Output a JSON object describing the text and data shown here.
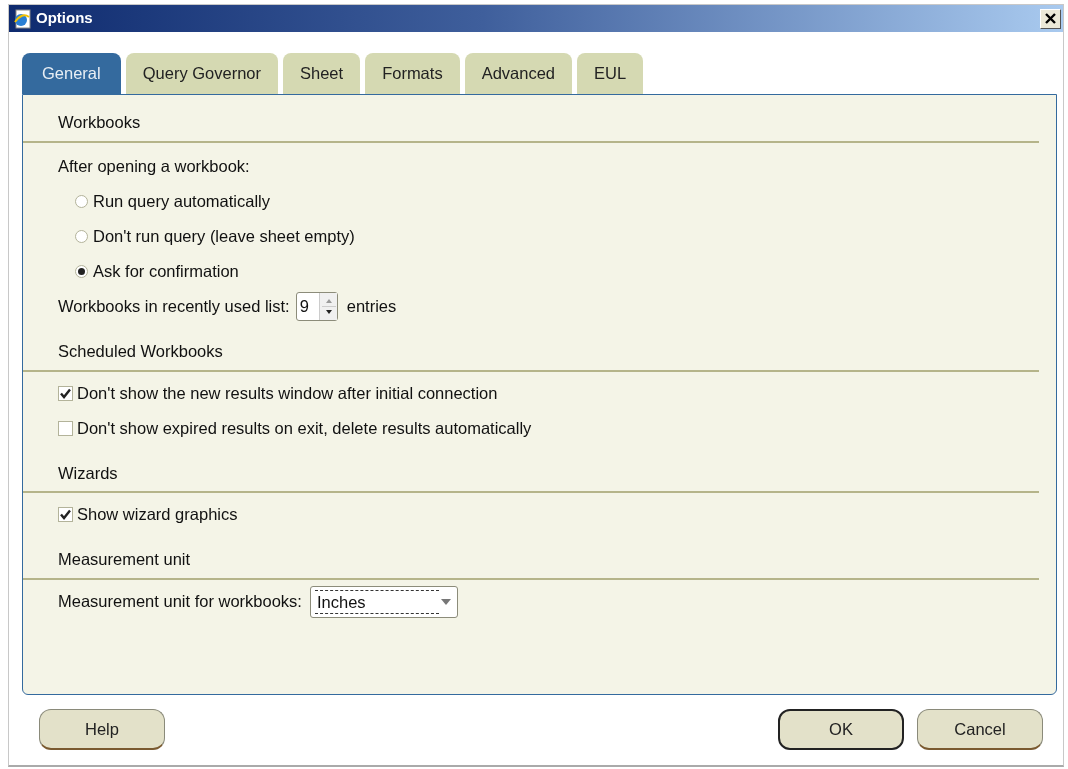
{
  "window": {
    "title": "Options"
  },
  "tabs": [
    {
      "label": "General",
      "selected": true
    },
    {
      "label": "Query Governor",
      "selected": false
    },
    {
      "label": "Sheet",
      "selected": false
    },
    {
      "label": "Formats",
      "selected": false
    },
    {
      "label": "Advanced",
      "selected": false
    },
    {
      "label": "EUL",
      "selected": false
    }
  ],
  "sections": [
    {
      "title": "Workbooks",
      "items": [
        {
          "kind": "label",
          "text": "After opening a workbook:"
        },
        {
          "kind": "radio",
          "label": "Run query automatically",
          "selected": false
        },
        {
          "kind": "radio",
          "label": "Don't run query (leave sheet empty)",
          "selected": false
        },
        {
          "kind": "radio",
          "label": "Ask for confirmation",
          "selected": true
        },
        {
          "kind": "spinner",
          "label": "Workbooks in recently used list:",
          "value": "9",
          "suffix": "entries"
        }
      ]
    },
    {
      "title": "Scheduled Workbooks",
      "items": [
        {
          "kind": "checkbox",
          "label": "Don't show the new results window after initial connection",
          "checked": true
        },
        {
          "kind": "checkbox",
          "label": "Don't show expired results on exit, delete results automatically",
          "checked": false
        }
      ]
    },
    {
      "title": "Wizards",
      "items": [
        {
          "kind": "checkbox",
          "label": "Show wizard graphics",
          "checked": true
        }
      ]
    },
    {
      "title": "Measurement unit",
      "items": [
        {
          "kind": "select",
          "label": "Measurement unit for workbooks:",
          "value": "Inches"
        }
      ]
    }
  ],
  "left_buttons": [
    {
      "label": "Help",
      "default": false
    }
  ],
  "right_buttons": [
    {
      "label": "OK",
      "default": true
    },
    {
      "label": "Cancel",
      "default": false
    }
  ]
}
